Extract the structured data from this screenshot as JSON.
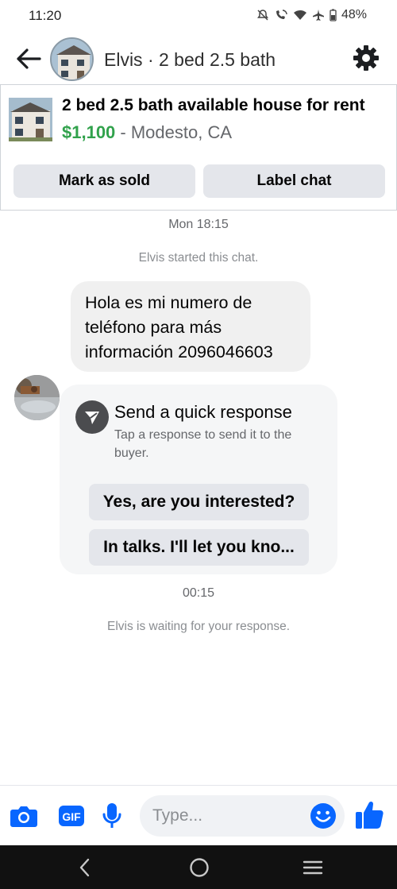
{
  "status_bar": {
    "time": "11:20",
    "battery": "48%"
  },
  "header": {
    "title": "Elvis · 2 bed 2.5 bath",
    "back_icon": "arrow-left-icon",
    "settings_icon": "gear-icon"
  },
  "listing": {
    "title": "2 bed 2.5 bath available house for rent",
    "price": "$1,100",
    "separator": " - ",
    "location": "Modesto, CA",
    "buttons": {
      "mark_sold": "Mark as sold",
      "label_chat": "Label chat"
    }
  },
  "chat": {
    "timestamp_1": "Mon 18:15",
    "system_started": "Elvis started this chat.",
    "message": "Hola es mi numero de teléfono para más información 2096046603",
    "quick_response": {
      "title": "Send a quick response",
      "subtitle": "Tap a response to send it to the buyer.",
      "option_1": "Yes, are you interested?",
      "option_2": "In talks. I'll let you kno..."
    },
    "timestamp_2": "00:15",
    "system_waiting": "Elvis is waiting for your response."
  },
  "composer": {
    "placeholder": "Type...",
    "gif_label": "GIF"
  },
  "colors": {
    "accent": "#0866ff",
    "price_green": "#31a24c",
    "bubble_gray": "#f0f0f0",
    "button_gray": "#e4e6eb"
  }
}
